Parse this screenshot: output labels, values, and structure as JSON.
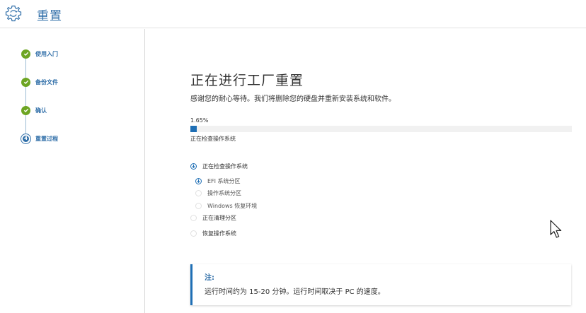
{
  "header": {
    "title": "重置",
    "icon": "reset-gear-icon"
  },
  "sidebar": {
    "steps": [
      {
        "label": "使用入门",
        "state": "done"
      },
      {
        "label": "备份文件",
        "state": "done"
      },
      {
        "label": "确认",
        "state": "done"
      },
      {
        "label": "重置过程",
        "state": "current",
        "number": "4"
      }
    ]
  },
  "main": {
    "title": "正在进行工厂重置",
    "description": "感谢您的耐心等待。我们将删除您的硬盘并重新安装系统和软件。",
    "progress": {
      "percent_text": "1.65%",
      "value": 1.65,
      "status": "正在检查操作系统"
    },
    "tasks": [
      {
        "label": "正在检查操作系统",
        "state": "active",
        "subtasks": [
          {
            "label": "EFI 系统分区",
            "state": "active"
          },
          {
            "label": "操作系统分区",
            "state": "pending"
          },
          {
            "label": "Windows 恢复环境",
            "state": "pending"
          }
        ]
      },
      {
        "label": "正在清理分区",
        "state": "pending"
      },
      {
        "label": "恢复操作系统",
        "state": "pending"
      }
    ],
    "note": {
      "title": "注:",
      "text": "运行时间约为 15-20 分钟。运行时间取决于 PC 的速度。"
    }
  },
  "colors": {
    "accent": "#1f6fb5",
    "done": "#6da523",
    "title": "#2f6ea8"
  }
}
